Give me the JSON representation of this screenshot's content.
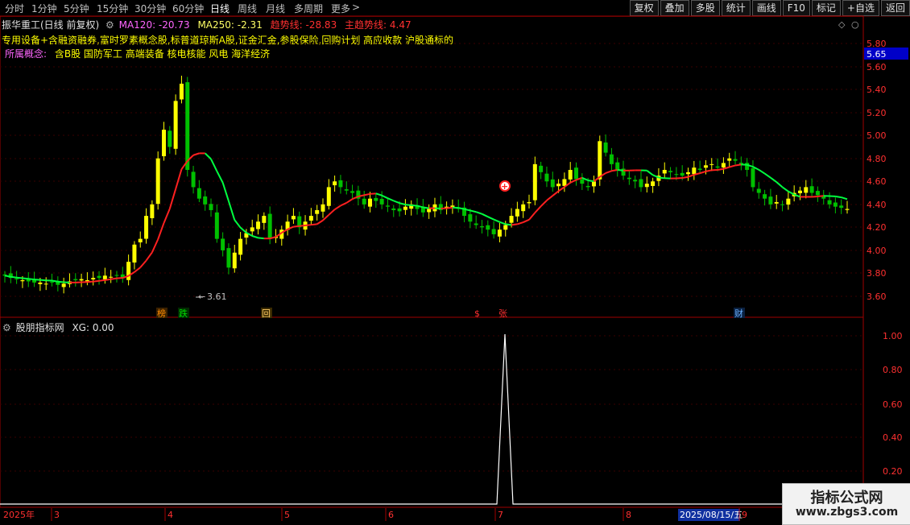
{
  "toolbar": {
    "timeframes": [
      {
        "label": "分时",
        "active": false
      },
      {
        "label": "1分钟",
        "active": false
      },
      {
        "label": "5分钟",
        "active": false
      },
      {
        "label": "15分钟",
        "active": false
      },
      {
        "label": "30分钟",
        "active": false
      },
      {
        "label": "60分钟",
        "active": false
      },
      {
        "label": "日线",
        "active": true
      },
      {
        "label": "周线",
        "active": false
      },
      {
        "label": "月线",
        "active": false
      },
      {
        "label": "多周期",
        "active": false
      },
      {
        "label": "更多",
        "active": false
      }
    ],
    "more_arrow": ">",
    "right_buttons": [
      "复权",
      "叠加",
      "多股",
      "统计",
      "画线",
      "F10",
      "标记",
      "+自选",
      "返回"
    ]
  },
  "main_header": {
    "title": "振华重工(日线 前复权)",
    "ma120": "MA120: -20.73",
    "ma250": "MA250: -2.31",
    "trend": "趋势线: -28.83",
    "main_trend": "主趋势线: 4.47"
  },
  "overlay": {
    "line1": "专用设备+含融资融券,富时罗素概念股,标普道琼斯A股,证金汇金,参股保险,回购计划 高应收款 沪股通标的",
    "line2_label": "所属概念:",
    "line2_text": "含B股 国防军工 高端装备 核电核能 风电 海洋经济"
  },
  "price_axis": {
    "ticks": [
      "5.80",
      "5.60",
      "5.40",
      "5.20",
      "5.00",
      "4.80",
      "4.60",
      "4.40",
      "4.20",
      "4.00",
      "3.80",
      "3.60"
    ],
    "current": "5.65"
  },
  "annotations": {
    "low_label": "3.61",
    "markers": [
      {
        "text": "榜",
        "color": "#ff8c00"
      },
      {
        "text": "跌",
        "color": "#00e000"
      },
      {
        "text": "回",
        "color": "#ffcc66"
      },
      {
        "text": "$",
        "color": "#ff3030"
      },
      {
        "text": "张",
        "color": "#ff3030"
      },
      {
        "text": "财",
        "color": "#6ab0ff"
      }
    ]
  },
  "indicator": {
    "title": "股朋指标网",
    "value": "XG: 0.00",
    "ticks": [
      "1.00",
      "0.80",
      "0.60",
      "0.40",
      "0.20"
    ]
  },
  "date_axis": {
    "labels": [
      "2025年",
      "3",
      "4",
      "5",
      "6",
      "7",
      "8",
      "9"
    ],
    "highlight": "2025/08/15/五"
  },
  "watermark": {
    "title": "指标公式网",
    "url": "www.zbgs3.com"
  },
  "colors": {
    "up": "#ffff00",
    "down": "#00c000",
    "ma_green": "#00ff40",
    "ma_red": "#ff2020",
    "grid": "#3a0000",
    "axis": "#a00000",
    "text_yellow": "#ffff00"
  }
}
